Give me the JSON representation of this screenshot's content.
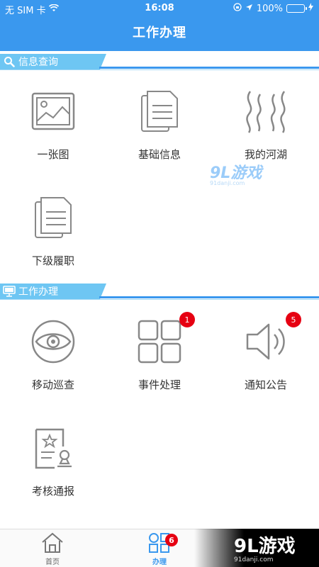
{
  "status_bar": {
    "carrier": "无 SIM 卡",
    "time": "16:08",
    "battery": "100%"
  },
  "nav": {
    "title": "工作办理"
  },
  "sections": [
    {
      "title": "信息查询",
      "items": [
        {
          "label": "一张图"
        },
        {
          "label": "基础信息"
        },
        {
          "label": "我的河湖"
        },
        {
          "label": "下级履职"
        }
      ]
    },
    {
      "title": "工作办理",
      "items": [
        {
          "label": "移动巡查"
        },
        {
          "label": "事件处理",
          "badge": "1"
        },
        {
          "label": "通知公告",
          "badge": "5"
        },
        {
          "label": "考核通报"
        }
      ]
    }
  ],
  "tabbar": {
    "home_label": "首页",
    "work_label": "办理",
    "work_badge": "6"
  },
  "watermark": {
    "small_logo": "9L游戏",
    "small_url": "91danji.com",
    "large_logo": "9L游戏",
    "large_url": "91danji.com"
  },
  "colors": {
    "primary": "#3a98ee",
    "section_tab": "#6ec6f3",
    "badge": "#e60012"
  }
}
